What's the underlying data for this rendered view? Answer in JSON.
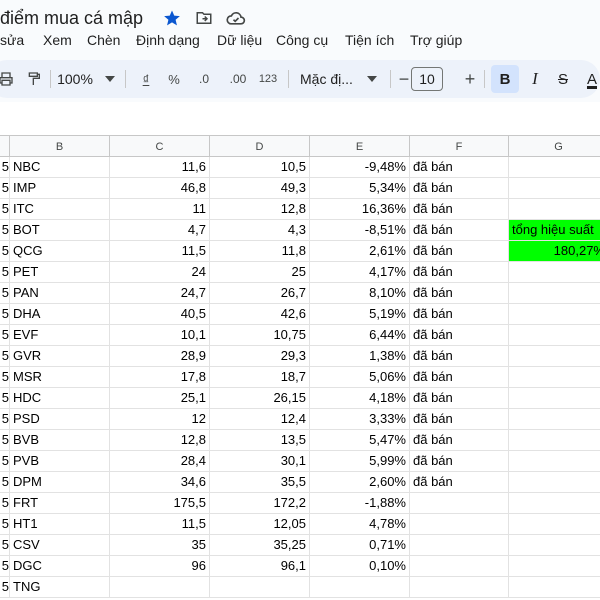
{
  "header": {
    "title": "điểm mua cá mập",
    "icons": [
      "star-icon",
      "move-to-folder-icon",
      "cloud-status-icon"
    ]
  },
  "menu": [
    "sửa",
    "Xem",
    "Chèn",
    "Định dạng",
    "Dữ liệu",
    "Công cụ",
    "Tiện ích",
    "Trợ giúp"
  ],
  "toolbar": {
    "zoom": "100%",
    "currency": "₫",
    "percent": "%",
    "decrease_decimal": ".0",
    "increase_decimal": ".00",
    "number_format": "123",
    "font_name": "Mặc đị...",
    "minus": "−",
    "font_size": "10",
    "plus": "+",
    "bold": "B",
    "italic": "I",
    "strike": "S",
    "text_color": "A",
    "accent": "#d3e3fd"
  },
  "sheet": {
    "columns": [
      "B",
      "C",
      "D",
      "E",
      "F",
      "G"
    ],
    "rows": [
      {
        "a": "5",
        "b": "NBC",
        "c": "11,6",
        "d": "10,5",
        "e": "-9,48%",
        "f": "đã bán",
        "g": ""
      },
      {
        "a": "5",
        "b": "IMP",
        "c": "46,8",
        "d": "49,3",
        "e": "5,34%",
        "f": "đã bán",
        "g": ""
      },
      {
        "a": "5",
        "b": "ITC",
        "c": "11",
        "d": "12,8",
        "e": "16,36%",
        "f": "đã bán",
        "g": ""
      },
      {
        "a": "5",
        "b": "BOT",
        "c": "4,7",
        "d": "4,3",
        "e": "-8,51%",
        "f": "đã bán",
        "g": "tổng hiệu suất"
      },
      {
        "a": "5",
        "b": "QCG",
        "c": "11,5",
        "d": "11,8",
        "e": "2,61%",
        "f": "đã bán",
        "g": "180,27%"
      },
      {
        "a": "5",
        "b": "PET",
        "c": "24",
        "d": "25",
        "e": "4,17%",
        "f": "đã bán",
        "g": ""
      },
      {
        "a": "5",
        "b": "PAN",
        "c": "24,7",
        "d": "26,7",
        "e": "8,10%",
        "f": "đã bán",
        "g": ""
      },
      {
        "a": "5",
        "b": "DHA",
        "c": "40,5",
        "d": "42,6",
        "e": "5,19%",
        "f": "đã bán",
        "g": ""
      },
      {
        "a": "5",
        "b": "EVF",
        "c": "10,1",
        "d": "10,75",
        "e": "6,44%",
        "f": "đã bán",
        "g": ""
      },
      {
        "a": "5",
        "b": "GVR",
        "c": "28,9",
        "d": "29,3",
        "e": "1,38%",
        "f": "đã bán",
        "g": ""
      },
      {
        "a": "5",
        "b": "MSR",
        "c": "17,8",
        "d": "18,7",
        "e": "5,06%",
        "f": "đã bán",
        "g": ""
      },
      {
        "a": "5",
        "b": "HDC",
        "c": "25,1",
        "d": "26,15",
        "e": "4,18%",
        "f": "đã bán",
        "g": ""
      },
      {
        "a": "5",
        "b": "PSD",
        "c": "12",
        "d": "12,4",
        "e": "3,33%",
        "f": "đã bán",
        "g": ""
      },
      {
        "a": "5",
        "b": "BVB",
        "c": "12,8",
        "d": "13,5",
        "e": "5,47%",
        "f": "đã bán",
        "g": ""
      },
      {
        "a": "5",
        "b": "PVB",
        "c": "28,4",
        "d": "30,1",
        "e": "5,99%",
        "f": "đã bán",
        "g": ""
      },
      {
        "a": "5",
        "b": "DPM",
        "c": "34,6",
        "d": "35,5",
        "e": "2,60%",
        "f": "đã bán",
        "g": ""
      },
      {
        "a": "5",
        "b": "FRT",
        "c": "175,5",
        "d": "172,2",
        "e": "-1,88%",
        "f": "",
        "g": ""
      },
      {
        "a": "5",
        "b": "HT1",
        "c": "11,5",
        "d": "12,05",
        "e": "4,78%",
        "f": "",
        "g": ""
      },
      {
        "a": "5",
        "b": "CSV",
        "c": "35",
        "d": "35,25",
        "e": "0,71%",
        "f": "",
        "g": ""
      },
      {
        "a": "5",
        "b": "DGC",
        "c": "96",
        "d": "96,1",
        "e": "0,10%",
        "f": "",
        "g": ""
      },
      {
        "a": "5",
        "b": "TNG",
        "c": "",
        "d": "",
        "e": "",
        "f": "",
        "g": ""
      }
    ],
    "highlight_color": "#00ff00"
  }
}
